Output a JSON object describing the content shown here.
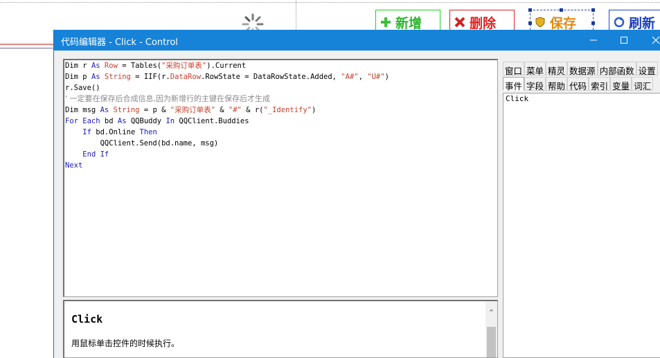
{
  "background": {
    "buttons": {
      "add": "新增",
      "delete": "删除",
      "save": "保存",
      "refresh": "刷新"
    },
    "colors": {
      "add": "#2bb52b",
      "delete": "#dd2222",
      "save": "#e08a10",
      "refresh": "#1d3fbf"
    }
  },
  "dialog": {
    "title": "代码编辑器 - Click - Control",
    "controls": [
      "minimize-icon",
      "maximize-icon",
      "close-icon"
    ],
    "titlebar_color": "#1683d8",
    "code": {
      "line1": {
        "p1": "Dim r ",
        "k1": "As",
        "p2": " ",
        "t1": "Row",
        "p3": " = Tables(",
        "s1": "\"采购订单表\"",
        "p4": ").Current"
      },
      "line2": {
        "p1": "Dim p ",
        "k1": "As",
        "p2": " ",
        "t1": "String",
        "p3": " = IIF(r.",
        "t2": "DataRow",
        "p4": ".RowState = DataRowState.Added, ",
        "s1": "\"A#\"",
        "p5": ", ",
        "s2": "\"U#\"",
        "p6": ")"
      },
      "line3": {
        "p1": "r.Save()"
      },
      "line4": {
        "c1": "' 一定要在保存后合成信息,因为新增行的主键在保存后才生成"
      },
      "line5": {
        "p1": "Dim msg ",
        "k1": "As",
        "p2": " ",
        "t1": "String",
        "p3": " = p & ",
        "s1": "\"采购订单表\"",
        "p4": " & ",
        "s2": "\"#\"",
        "p5": " & r(",
        "s3": "\"_Identify\"",
        "p6": ")"
      },
      "line6": {
        "k1": "For Each",
        "p1": " bd ",
        "k2": "As",
        "p2": " QQBuddy ",
        "k3": "In",
        "p3": " QQClient.Buddies"
      },
      "line7": {
        "p0": "    ",
        "k1": "If",
        "p1": " bd.Online ",
        "k2": "Then"
      },
      "line8": {
        "p1": "        QQClient.Send(bd.name, msg)"
      },
      "line9": {
        "p0": "    ",
        "k1": "End If"
      },
      "line10": {
        "k1": "Next"
      }
    },
    "help": {
      "title": "Click",
      "description": "用鼠标单击控件的时候执行。"
    },
    "tabs_row1": [
      "窗口",
      "菜单",
      "精灵",
      "数据源",
      "内部函数",
      "设置"
    ],
    "tabs_row2": [
      "事件",
      "字段",
      "帮助",
      "代码",
      "索引",
      "变量",
      "词汇"
    ],
    "active_tab": "事件",
    "events_list": [
      "Click"
    ]
  }
}
